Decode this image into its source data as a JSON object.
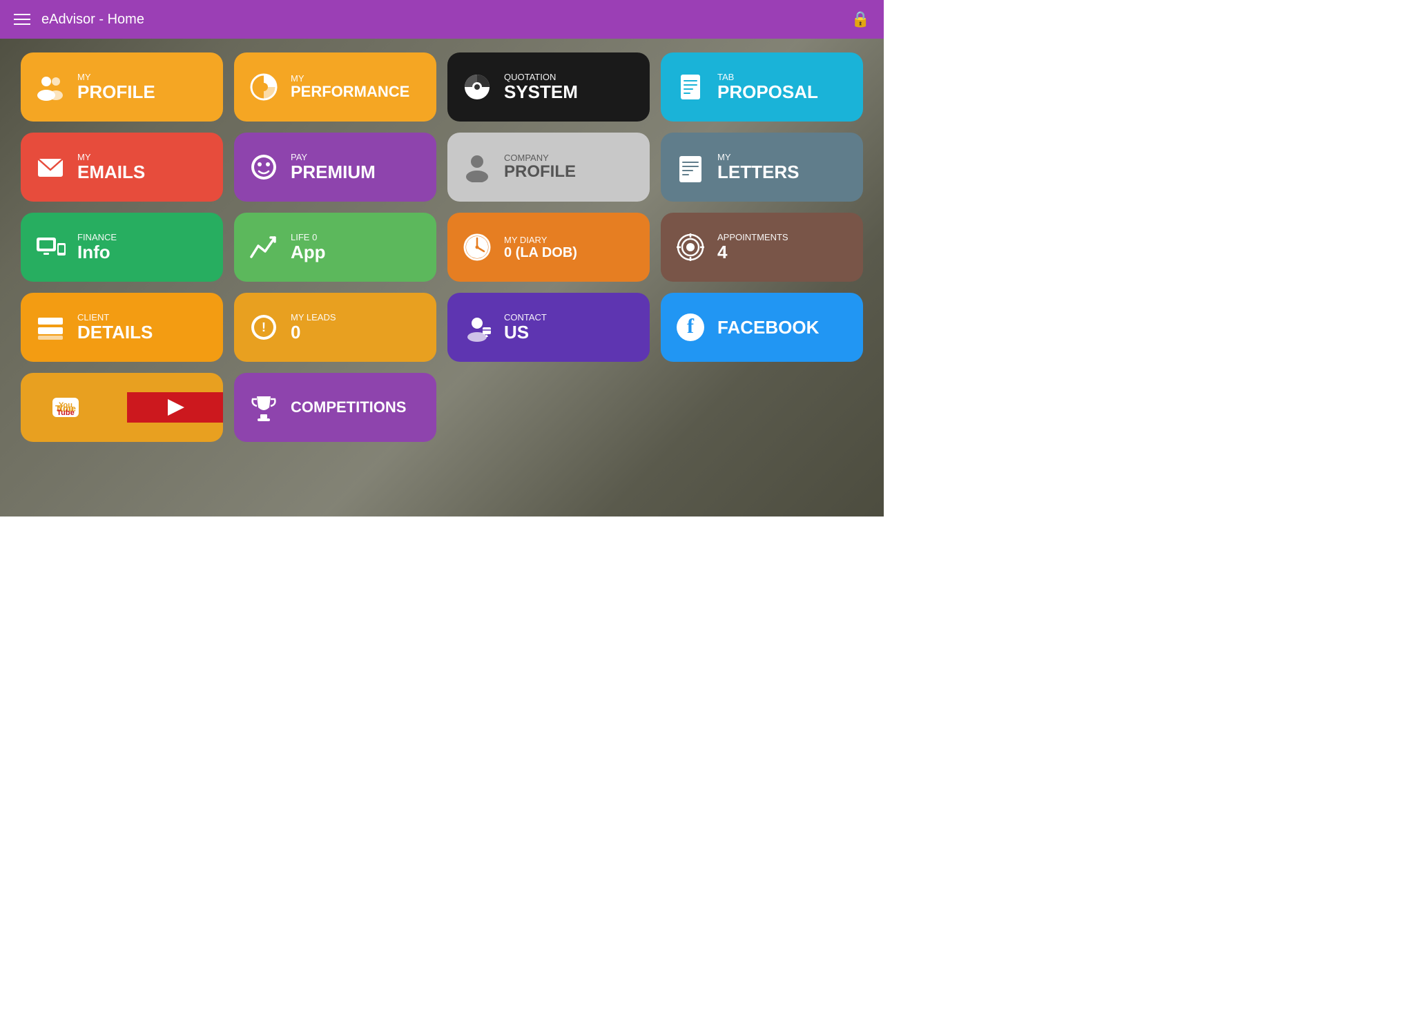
{
  "topbar": {
    "title": "eAdvisor -  Home"
  },
  "tiles": [
    {
      "id": "my-profile",
      "small": "MY",
      "big": "PROFILE",
      "color": "orange",
      "icon": "people"
    },
    {
      "id": "my-performance",
      "small": "MY",
      "big": "PERFORMANCE",
      "color": "orange",
      "icon": "pie"
    },
    {
      "id": "quotation-system",
      "small": "QUOTATION",
      "big": "SYSTEM",
      "color": "black",
      "icon": "pie-bw"
    },
    {
      "id": "tab-proposal",
      "small": "TAB",
      "big": "PROPOSAL",
      "color": "cyan",
      "icon": "doc"
    },
    {
      "id": "my-emails",
      "small": "MY",
      "big": "EMAILS",
      "color": "red",
      "icon": "mail"
    },
    {
      "id": "pay-premium",
      "small": "PAY",
      "big": "PREMIUM",
      "color": "purple",
      "icon": "face"
    },
    {
      "id": "company-profile",
      "small": "COMPANY",
      "big": "PROFILE",
      "color": "gray-light",
      "icon": "person-gray"
    },
    {
      "id": "my-letters",
      "small": "MY",
      "big": "LETTERS",
      "color": "gray-tile",
      "icon": "letter"
    },
    {
      "id": "finance-info",
      "small": "Finance",
      "big": "Info",
      "color": "green",
      "icon": "devices"
    },
    {
      "id": "life-app",
      "small": "Life 0",
      "big": "App",
      "color": "green2",
      "icon": "chart"
    },
    {
      "id": "my-diary",
      "small": "MY DIARY",
      "big": "0 (LA DOB)",
      "color": "orange2",
      "icon": "clock"
    },
    {
      "id": "appointments",
      "small": "APPOINTMENTS",
      "big": "4",
      "color": "brown",
      "icon": "target"
    },
    {
      "id": "client-details",
      "small": "CLIENT",
      "big": "DETAILS",
      "color": "amber",
      "icon": "rows"
    },
    {
      "id": "my-leads",
      "small": "MY LEADS",
      "big": "0",
      "color": "yellow-orange",
      "icon": "badge"
    },
    {
      "id": "contact-us",
      "small": "CONTACT",
      "big": "US",
      "color": "blue-purple",
      "icon": "contact"
    },
    {
      "id": "facebook",
      "small": "",
      "big": "FACEBOOK",
      "color": "blue",
      "icon": "facebook"
    },
    {
      "id": "youtube",
      "small": "",
      "big": "",
      "color": "youtube",
      "icon": "youtube"
    },
    {
      "id": "competitions",
      "small": "",
      "big": "COMPETITIONS",
      "color": "purple",
      "icon": "trophy"
    }
  ]
}
